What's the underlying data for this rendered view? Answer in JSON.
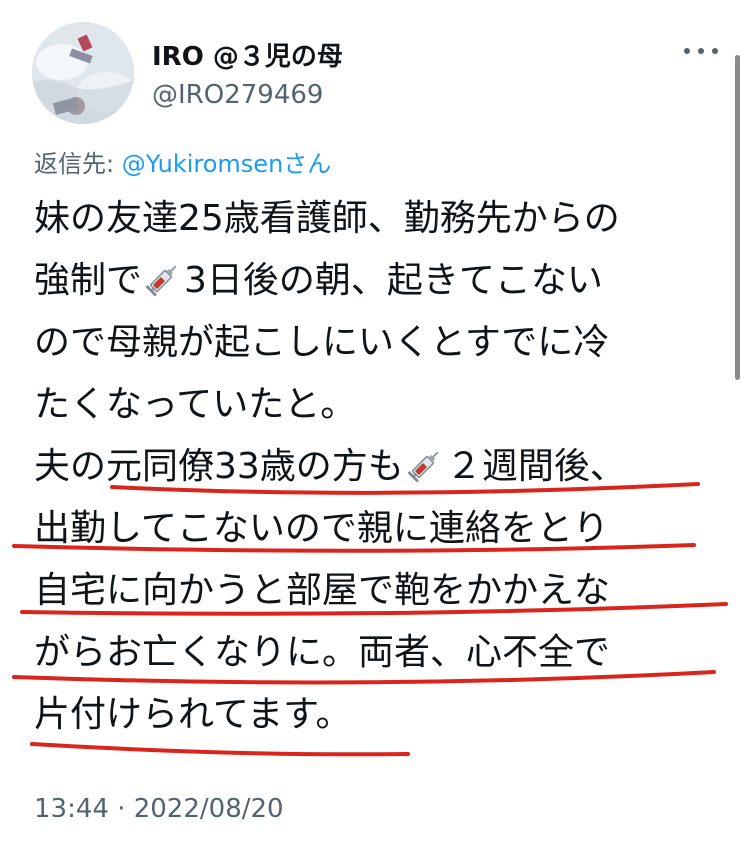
{
  "tweet": {
    "display_name": "IRO @３児の母",
    "handle": "@IRO279469",
    "reply_label": "返信先: ",
    "reply_mention": "@Yukiromsen",
    "reply_suffix": "さん",
    "lines": [
      {
        "a": "妹の友達25歳看護師、勤務先からの",
        "b": ""
      },
      {
        "a": "強制で",
        "b": "3日後の朝、起きてこない"
      },
      {
        "a": "ので母親が起こしにいくとすでに冷",
        "b": ""
      },
      {
        "a": "たくなっていたと。",
        "b": ""
      },
      {
        "a": "夫の元同僚33歳の方も",
        "b": "２週間後、"
      },
      {
        "a": "出勤してこないので親に連絡をとり",
        "b": ""
      },
      {
        "a": "自宅に向かうと部屋で鞄をかかえな",
        "b": ""
      },
      {
        "a": "がらお亡くなりに。両者、心不全で",
        "b": ""
      },
      {
        "a": "片付けられてます。",
        "b": ""
      }
    ],
    "timestamp": "13:44 · 2022/08/20",
    "icons": {
      "avatar": "snow-photo-avatar",
      "more": "more-options-icon",
      "emoji": "syringe-emoji"
    },
    "colors": {
      "text": "#0f1419",
      "secondary": "#536471",
      "link": "#1d9bf0",
      "annotation": "#d9251c"
    }
  }
}
